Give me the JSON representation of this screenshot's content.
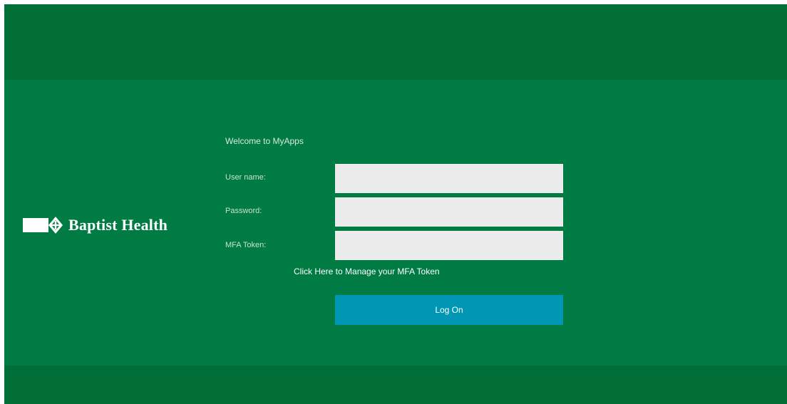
{
  "brand": {
    "name": "Baptist Health",
    "logo_icon": "baptist-health-logo-icon"
  },
  "form": {
    "welcome": "Welcome to MyApps",
    "username_label": "User name:",
    "username_value": "",
    "password_label": "Password:",
    "password_value": "",
    "mfa_label": "MFA Token:",
    "mfa_value": "",
    "mfa_link": "Click Here to Manage your MFA Token",
    "logon_button": "Log On"
  },
  "colors": {
    "header_band": "#016e38",
    "main_band": "#007b43",
    "input_bg": "#ececec",
    "button_bg": "#0197b4"
  }
}
